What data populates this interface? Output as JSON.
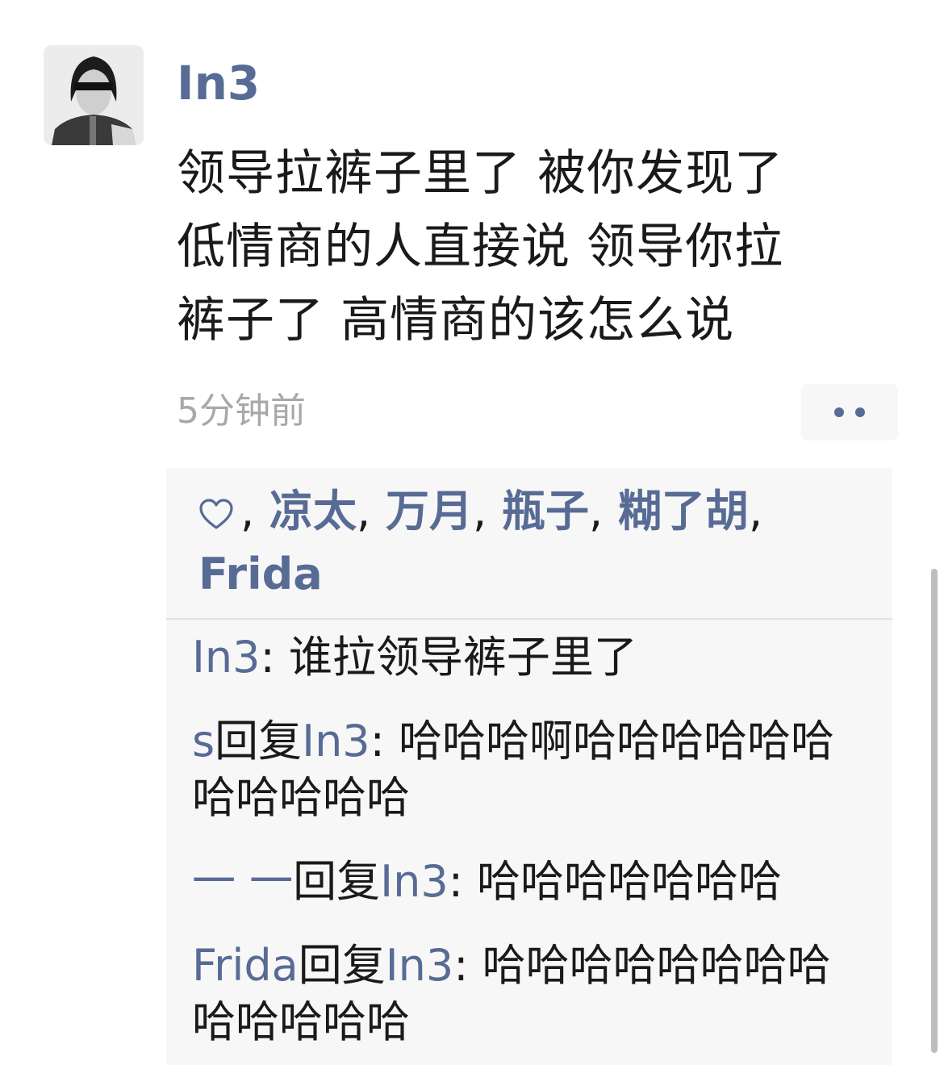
{
  "post": {
    "username": "In3",
    "text_lines": [
      "领导拉裤子里了 被你发现了",
      "低情商的人直接说 领导你拉",
      "裤子了 高情商的该怎么说"
    ],
    "timestamp": "5分钟前"
  },
  "likes": {
    "icon": "heart-outline-icon",
    "lead_separator": ",",
    "separator": ",",
    "names": [
      "凉太",
      "万月",
      "瓶子",
      "糊了胡",
      "Frida"
    ]
  },
  "comments": [
    {
      "author": "In3",
      "reply_word": "",
      "reply_to": "",
      "colon": ":",
      "text": " 谁拉领导裤子里了"
    },
    {
      "author": "s",
      "reply_word": "回复",
      "reply_to": "In3",
      "colon": ":",
      "text": " 哈哈哈啊哈哈哈哈哈哈哈哈哈哈哈"
    },
    {
      "author": "一 一",
      "reply_word": "回复",
      "reply_to": "In3",
      "colon": ":",
      "text": " 哈哈哈哈哈哈哈"
    },
    {
      "author": "Frida",
      "reply_word": "回复",
      "reply_to": "In3",
      "colon": ":",
      "text": " 哈哈哈哈哈哈哈哈哈哈哈哈哈"
    }
  ],
  "colors": {
    "link": "#576b95",
    "text": "#1a1a1a",
    "timestamp": "#a8a8a8",
    "comment_bg": "#f7f7f7"
  }
}
